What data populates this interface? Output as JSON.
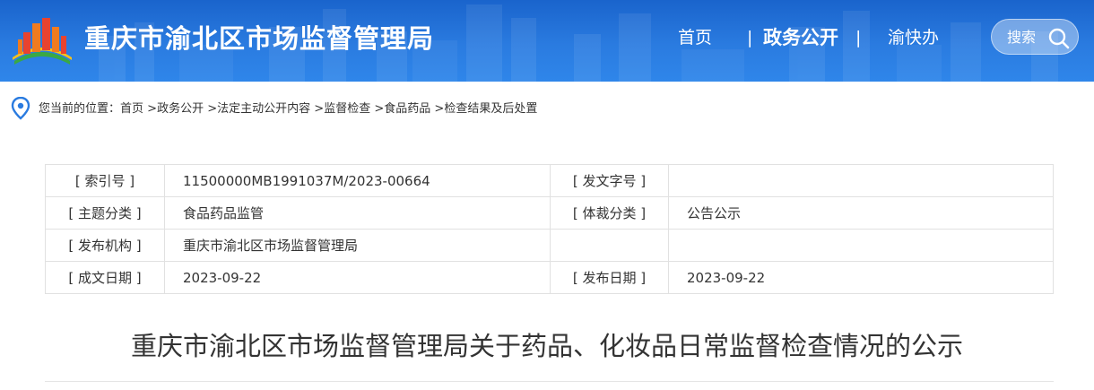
{
  "header": {
    "site_title": "重庆市渝北区市场监督管理局",
    "nav": {
      "home": "首页",
      "separator": "|",
      "gov_affairs": "政务公开",
      "yukuaiban": "渝快办"
    },
    "search_label": "搜索",
    "colors": {
      "bar": "#2a7be0",
      "accent": "#ffffff"
    }
  },
  "breadcrumb": {
    "prefix": "您当前的位置：",
    "items": [
      "首页",
      "政务公开",
      "法定主动公开内容",
      "监督检查",
      "食品药品",
      "检查结果及后处置"
    ],
    "separator": ">"
  },
  "info_table": {
    "rows": [
      {
        "label1": "[ 索引号 ]",
        "value1": "11500000MB1991037M/2023-00664",
        "label2": "[ 发文字号 ]",
        "value2": ""
      },
      {
        "label1": "[ 主题分类 ]",
        "value1": "食品药品监管",
        "label2": "[ 体裁分类 ]",
        "value2": "公告公示"
      },
      {
        "label1": "[ 发布机构 ]",
        "value1": "重庆市渝北区市场监督管理局",
        "label2": "",
        "value2": ""
      },
      {
        "label1": "[ 成文日期 ]",
        "value1": "2023-09-22",
        "label2": "[ 发布日期 ]",
        "value2": "2023-09-22"
      }
    ]
  },
  "article": {
    "title": "重庆市渝北区市场监督管理局关于药品、化妆品日常监督检查情况的公示"
  }
}
